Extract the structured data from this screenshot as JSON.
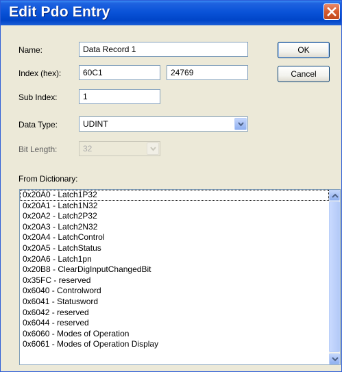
{
  "window": {
    "title": "Edit Pdo Entry"
  },
  "form": {
    "name_label": "Name:",
    "name_value": "Data Record 1",
    "index_label": "Index (hex):",
    "index_hex": "60C1",
    "index_dec": "24769",
    "subindex_label": "Sub Index:",
    "subindex_value": "1",
    "datatype_label": "Data Type:",
    "datatype_value": "UDINT",
    "bitlength_label": "Bit Length:",
    "bitlength_value": "32"
  },
  "buttons": {
    "ok": "OK",
    "cancel": "Cancel"
  },
  "dictionary": {
    "label": "From Dictionary:",
    "items": [
      "0x20A0 - Latch1P32",
      "0x20A1 - Latch1N32",
      "0x20A2 - Latch2P32",
      "0x20A3 - Latch2N32",
      "0x20A4 - LatchControl",
      "0x20A5 - LatchStatus",
      "0x20A6 - Latch1pn",
      "0x20B8 - ClearDigInputChangedBit",
      "0x35FC - reserved",
      "0x6040 - Controlword",
      "0x6041 - Statusword",
      "0x6042 - reserved",
      "0x6044 - reserved",
      "0x6060 - Modes of Operation",
      "0x6061 - Modes of Operation Display"
    ]
  },
  "icons": {
    "close": "close-icon",
    "dropdown": "chevron-down-icon"
  },
  "colors": {
    "titlebar": "#0a53d8",
    "close": "#d65b2e",
    "window_bg": "#ece9d8"
  }
}
